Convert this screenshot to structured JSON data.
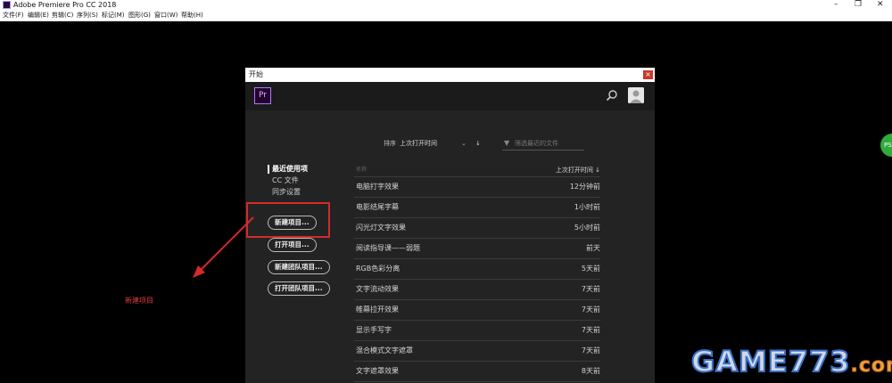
{
  "app": {
    "title": "Adobe Premiere Pro CC 2018"
  },
  "window_controls": [
    "–",
    "❐",
    "✕"
  ],
  "menu": [
    "文件(F)",
    "编辑(E)",
    "剪辑(C)",
    "序列(S)",
    "标记(M)",
    "图形(G)",
    "窗口(W)",
    "帮助(H)"
  ],
  "dialog": {
    "title": "开始",
    "close_symbol": "×",
    "logo": "Pr",
    "icons": {
      "search": "search-icon",
      "avatar": "user-avatar-icon"
    },
    "sort": {
      "label": "排序",
      "value": "上次打开时间",
      "chevron": "⌄",
      "direction": "↓"
    },
    "filter": {
      "icon": "filter-icon",
      "placeholder": "筛选最近的文件"
    },
    "nav": [
      {
        "label": "最近使用项",
        "active": true
      },
      {
        "label": "CC 文件",
        "active": false
      },
      {
        "label": "同步设置",
        "active": false
      }
    ],
    "buttons": {
      "new_project": "新建项目...",
      "open_project": "打开项目...",
      "new_team_project": "新建团队项目...",
      "open_team_project": "打开团队项目..."
    },
    "table": {
      "col_name": "名称",
      "col_time": "上次打开时间 ↓",
      "rows": [
        {
          "name": "电脑打字效果",
          "time": "12分钟前"
        },
        {
          "name": "电影结尾字幕",
          "time": "1小时前"
        },
        {
          "name": "闪光灯文字效果",
          "time": "5小时前"
        },
        {
          "name": "阅读指导课——弱题",
          "time": "前天"
        },
        {
          "name": "RGB色彩分离",
          "time": "5天前"
        },
        {
          "name": "文字流动效果",
          "time": "7天前"
        },
        {
          "name": "帷幕拉开效果",
          "time": "7天前"
        },
        {
          "name": "显示手写字",
          "time": "7天前"
        },
        {
          "name": "混合模式文字遮罩",
          "time": "7天前"
        },
        {
          "name": "文字遮罩效果",
          "time": "8天前"
        }
      ]
    }
  },
  "annotation": {
    "label": "新建项目",
    "color": "#d42a2a"
  },
  "side_bubble": {
    "text": "PS"
  },
  "watermark": {
    "main": "GAME773",
    "suffix": ".com"
  }
}
